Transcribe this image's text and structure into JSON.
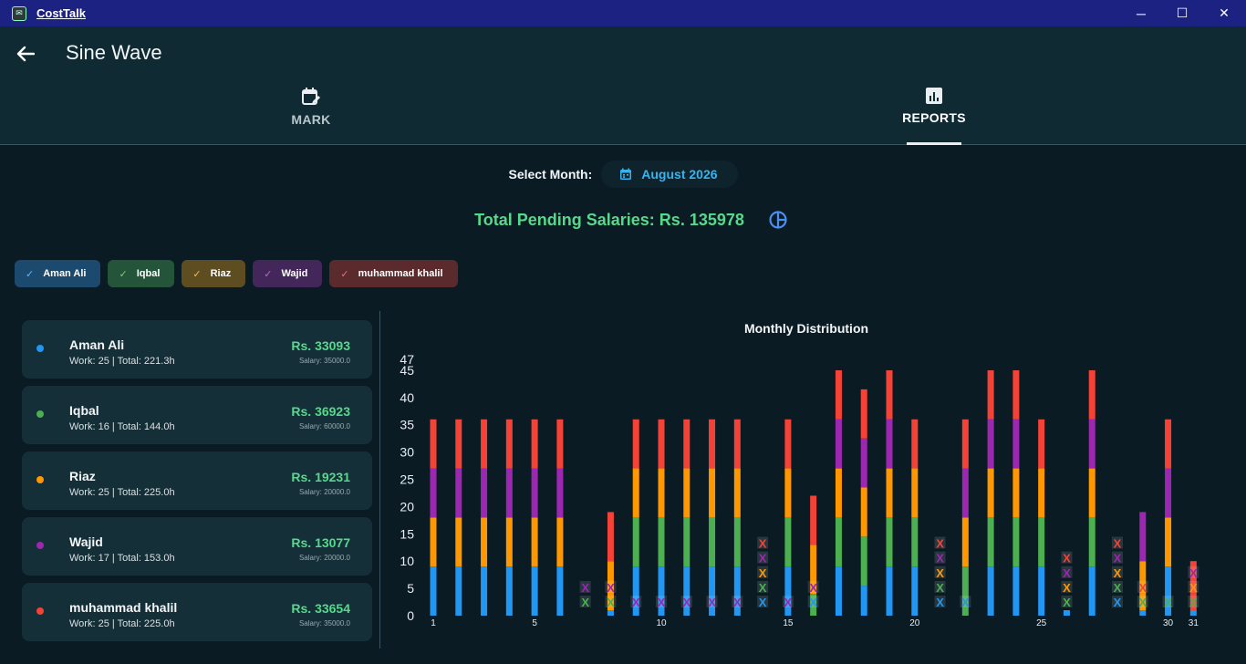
{
  "app": {
    "title": "CostTalk"
  },
  "window": {
    "minimize": "─",
    "maximize": "☐",
    "close": "✕"
  },
  "header": {
    "title": "Sine Wave",
    "tabs": [
      {
        "label": "MARK",
        "icon": "calendar-edit-icon",
        "active": false
      },
      {
        "label": "REPORTS",
        "icon": "bar-chart-icon",
        "active": true
      }
    ]
  },
  "month": {
    "label": "Select Month:",
    "value": "August 2026",
    "icon": "calendar-icon"
  },
  "total": {
    "text": "Total Pending Salaries: Rs. 135978",
    "icon": "pie-chart-icon"
  },
  "colors": {
    "aman": "#2196f3",
    "iqbal": "#4caf50",
    "riaz": "#ff9800",
    "wajid": "#9c27b0",
    "khalil": "#f44336",
    "accent": "#56d98b"
  },
  "filters": [
    {
      "label": "Aman Ali",
      "checked": true,
      "color": "#2196f3"
    },
    {
      "label": "Iqbal",
      "checked": true,
      "color": "#4caf50"
    },
    {
      "label": "Riaz",
      "checked": true,
      "color": "#ff9800"
    },
    {
      "label": "Wajid",
      "checked": true,
      "color": "#9c27b0"
    },
    {
      "label": "muhammad khalil",
      "checked": true,
      "color": "#f44336"
    }
  ],
  "employees": [
    {
      "name": "Aman Ali",
      "meta": "Work: 25 | Total: 221.3h",
      "amount": "Rs. 33093",
      "salary": "Salary: 35000.0",
      "color": "#2196f3"
    },
    {
      "name": "Iqbal",
      "meta": "Work: 16 | Total: 144.0h",
      "amount": "Rs. 36923",
      "salary": "Salary: 60000.0",
      "color": "#4caf50"
    },
    {
      "name": "Riaz",
      "meta": "Work: 25 | Total: 225.0h",
      "amount": "Rs. 19231",
      "salary": "Salary: 20000.0",
      "color": "#ff9800"
    },
    {
      "name": "Wajid",
      "meta": "Work: 17 | Total: 153.0h",
      "amount": "Rs. 13077",
      "salary": "Salary: 20000.0",
      "color": "#9c27b0"
    },
    {
      "name": "muhammad khalil",
      "meta": "Work: 25 | Total: 225.0h",
      "amount": "Rs. 33654",
      "salary": "Salary: 35000.0",
      "color": "#f44336"
    }
  ],
  "chart_data": {
    "type": "bar",
    "title": "Monthly Distribution",
    "stacked": true,
    "ylim": [
      0,
      47
    ],
    "yticks": [
      0,
      5,
      10,
      15,
      20,
      25,
      30,
      35,
      40,
      45,
      47
    ],
    "xtick_labels": [
      "1",
      "5",
      "10",
      "15",
      "20",
      "25",
      "30",
      "31"
    ],
    "xtick_days": [
      1,
      5,
      10,
      15,
      20,
      25,
      30,
      31
    ],
    "absent_marker": "X",
    "days": [
      1,
      2,
      3,
      4,
      5,
      6,
      7,
      8,
      9,
      10,
      11,
      12,
      13,
      14,
      15,
      16,
      17,
      18,
      19,
      20,
      21,
      22,
      23,
      24,
      25,
      26,
      27,
      28,
      29,
      30,
      31
    ],
    "series": [
      {
        "name": "Aman Ali",
        "color": "#2196f3",
        "values": [
          9,
          9,
          9,
          9,
          9,
          9,
          0,
          1,
          9,
          9,
          9,
          9,
          9,
          0,
          9,
          0,
          9,
          5.5,
          9,
          9,
          0,
          0,
          9,
          9,
          9,
          1,
          9,
          0,
          1,
          9,
          1
        ]
      },
      {
        "name": "Iqbal",
        "color": "#4caf50",
        "values": [
          0,
          0,
          0,
          0,
          0,
          0,
          0,
          0,
          9,
          9,
          9,
          9,
          9,
          0,
          9,
          4,
          9,
          9,
          9,
          9,
          0,
          9,
          9,
          9,
          9,
          0,
          9,
          0,
          0,
          0,
          0
        ]
      },
      {
        "name": "Riaz",
        "color": "#ff9800",
        "values": [
          9,
          9,
          9,
          9,
          9,
          9,
          0,
          9,
          9,
          9,
          9,
          9,
          9,
          0,
          9,
          9,
          9,
          9,
          9,
          9,
          0,
          9,
          9,
          9,
          9,
          0,
          9,
          0,
          9,
          9,
          0
        ]
      },
      {
        "name": "Wajid",
        "color": "#9c27b0",
        "values": [
          9,
          9,
          9,
          9,
          9,
          9,
          0,
          0,
          0,
          0,
          0,
          0,
          0,
          0,
          0,
          0,
          9,
          9,
          9,
          0,
          0,
          9,
          9,
          9,
          0,
          0,
          9,
          0,
          9,
          9,
          0
        ]
      },
      {
        "name": "muhammad khalil",
        "color": "#f44336",
        "values": [
          9,
          9,
          9,
          9,
          9,
          9,
          0,
          9,
          9,
          9,
          9,
          9,
          9,
          0,
          9,
          9,
          9,
          9,
          9,
          9,
          0,
          9,
          9,
          9,
          9,
          0,
          9,
          0,
          0,
          9,
          9
        ]
      }
    ],
    "absences": {
      "7": [
        "Iqbal",
        "Wajid"
      ],
      "8": [
        "Iqbal",
        "Wajid"
      ],
      "9": [
        "Wajid"
      ],
      "10": [
        "Wajid"
      ],
      "11": [
        "Wajid"
      ],
      "12": [
        "Wajid"
      ],
      "13": [
        "Wajid"
      ],
      "14": [
        "Aman Ali",
        "Iqbal",
        "Riaz",
        "Wajid",
        "muhammad khalil"
      ],
      "15": [
        "Wajid"
      ],
      "16": [
        "Aman Ali",
        "Wajid"
      ],
      "21": [
        "Aman Ali",
        "Iqbal",
        "Riaz",
        "Wajid",
        "muhammad khalil"
      ],
      "22": [
        "Aman Ali"
      ],
      "26": [
        "Iqbal",
        "Riaz",
        "Wajid",
        "muhammad khalil"
      ],
      "28": [
        "Aman Ali",
        "Iqbal",
        "Riaz",
        "Wajid",
        "muhammad khalil"
      ],
      "29": [
        "Iqbal",
        "muhammad khalil"
      ],
      "30": [
        "Iqbal"
      ],
      "31": [
        "Iqbal",
        "Riaz",
        "Wajid"
      ]
    }
  }
}
